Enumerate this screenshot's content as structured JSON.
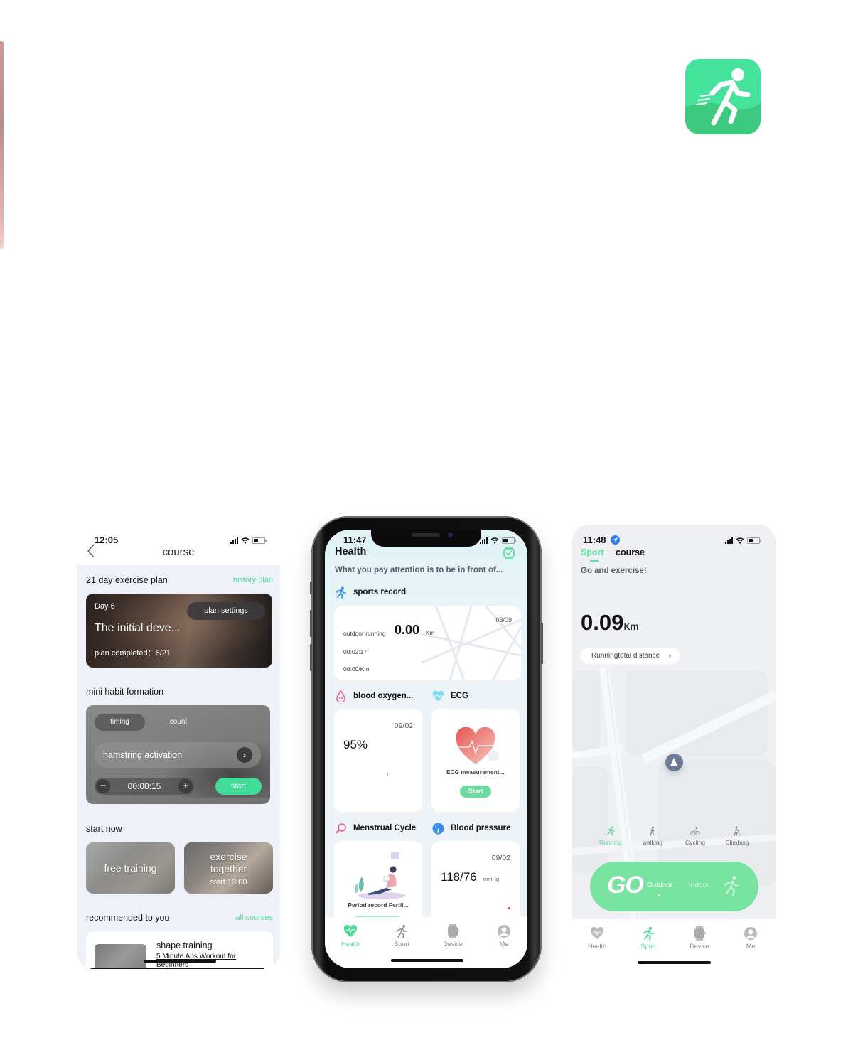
{
  "brand": {
    "accent": "#45e29c",
    "accent_dark": "#4ddc9a",
    "text_dark": "#111111"
  },
  "app_icon": {
    "icon": "running-man-icon",
    "label": ""
  },
  "course_screen": {
    "status": {
      "time": "12:05"
    },
    "header": {
      "title": "course",
      "back_icon": "chevron-left-icon"
    },
    "plan_section": {
      "title": "21 day exercise plan",
      "link": "history plan",
      "card": {
        "day": "Day 6",
        "name": "The initial deve...",
        "completed": "plan completed：6/21",
        "settings_button": "plan settings"
      }
    },
    "habit_section": {
      "title": "mini habit formation",
      "tabs": [
        {
          "label": "timing",
          "active": true
        },
        {
          "label": "count",
          "active": false
        }
      ],
      "exercise": "hamstring activation",
      "timer": {
        "value": "00:00:15",
        "minus": "−",
        "plus": "+"
      },
      "start_button": "start"
    },
    "start_now": {
      "title": "start now",
      "tiles": [
        {
          "label": "free training"
        },
        {
          "label_line1": "exercise",
          "label_line2": "together",
          "sub": "start  13:00"
        }
      ]
    },
    "recommended": {
      "title": "recommended to you",
      "link": "all courses",
      "items": [
        {
          "title": "shape training",
          "subtitle": "5 Minute Abs Workout for Beginners"
        }
      ]
    }
  },
  "health_screen": {
    "status": {
      "time": "11:47"
    },
    "title": "Health",
    "watch_icon": "watch-check-icon",
    "motto": "What you pay attention is to be in front of...",
    "sports_record": {
      "title": "sports record",
      "date": "03/09",
      "type": "outdoor running",
      "distance": "0.00",
      "distance_unit": "Km",
      "duration": "00:02:17",
      "pace": "00:00/Km"
    },
    "blood_oxygen": {
      "title": "blood oxygen...",
      "date": "09/02",
      "value": "95%"
    },
    "ecg": {
      "title": "ECG",
      "label": "ECG measurement...",
      "button": "Start"
    },
    "menstrual": {
      "title": "Menstrual Cycle",
      "label": "Period record Fertil..."
    },
    "blood_pressure": {
      "title": "Blood pressure",
      "date": "09/02",
      "value": "118/76",
      "unit": "mmHg"
    },
    "tabbar": [
      {
        "label": "Health",
        "icon": "heart-pulse-icon",
        "active": true
      },
      {
        "label": "Sport",
        "icon": "runner-icon",
        "active": false
      },
      {
        "label": "Device",
        "icon": "watch-icon",
        "active": false
      },
      {
        "label": "Me",
        "icon": "user-icon",
        "active": false
      }
    ]
  },
  "sport_screen": {
    "status": {
      "time": "11:48"
    },
    "tabs": [
      {
        "label": "Sport",
        "active": true
      },
      {
        "label": "course",
        "active": false
      }
    ],
    "tagline": "Go and exercise!",
    "distance": "0.09",
    "distance_unit": "Km",
    "total_button": "Runningtotal distance",
    "modes": [
      {
        "label": "Running",
        "icon": "running-icon",
        "active": true
      },
      {
        "label": "walking",
        "icon": "walking-icon",
        "active": false
      },
      {
        "label": "Cycling",
        "icon": "cycling-icon",
        "active": false
      },
      {
        "label": "Climbing",
        "icon": "climbing-icon",
        "active": false
      }
    ],
    "go_button": {
      "label": "GO",
      "outdoor": "Outdoor",
      "indoor": "Indoor",
      "selected": "Outdoor"
    },
    "tabbar": [
      {
        "label": "Health",
        "icon": "heart-pulse-icon",
        "active": false
      },
      {
        "label": "Sport",
        "icon": "runner-icon",
        "active": true
      },
      {
        "label": "Device",
        "icon": "watch-icon",
        "active": false
      },
      {
        "label": "Me",
        "icon": "user-icon",
        "active": false
      }
    ]
  }
}
